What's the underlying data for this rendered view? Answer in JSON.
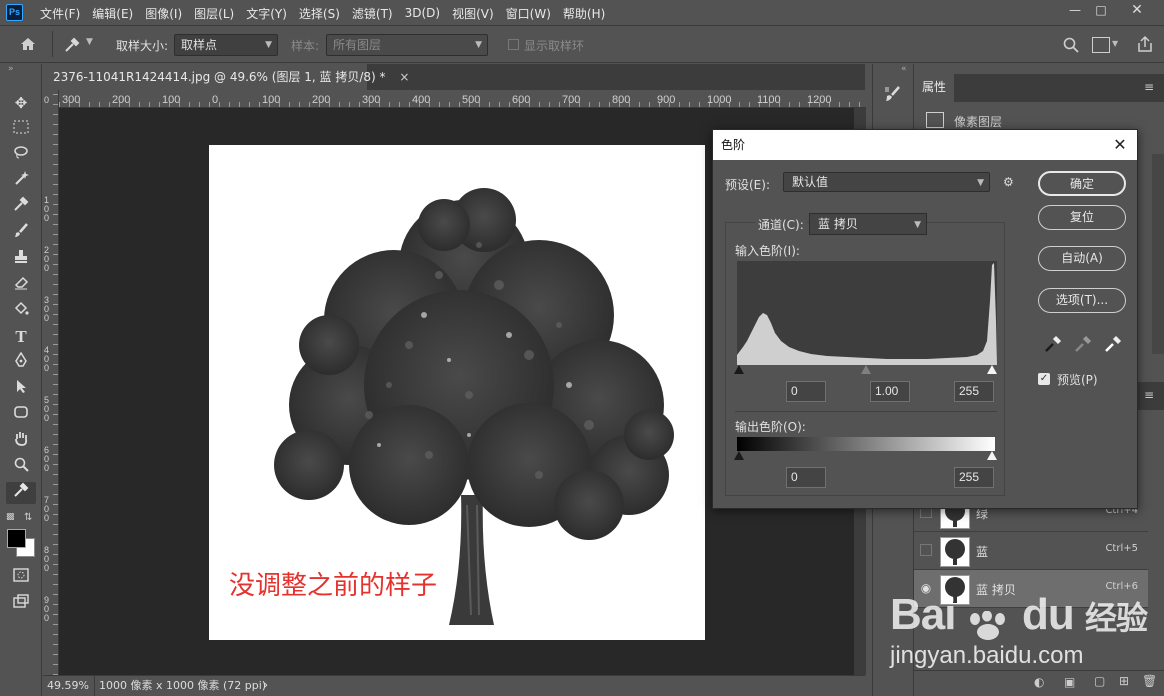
{
  "menubar": {
    "logo": "Ps",
    "items": [
      "文件(F)",
      "编辑(E)",
      "图像(I)",
      "图层(L)",
      "文字(Y)",
      "选择(S)",
      "滤镜(T)",
      "3D(D)",
      "视图(V)",
      "窗口(W)",
      "帮助(H)"
    ]
  },
  "options": {
    "sample_size_label": "取样大小:",
    "sample_size_value": "取样点",
    "sample_label": "样本:",
    "sample_value": "所有图层",
    "show_ring_label": "显示取样环"
  },
  "document": {
    "tab_title": "2376-11041R1424414.jpg @ 49.6% (图层 1, 蓝 拷贝/8) *",
    "close_glyph": "×",
    "annotation": "没调整之前的样子"
  },
  "rulers": {
    "h_ticks": [
      "300",
      "200",
      "100",
      "0",
      "100",
      "200",
      "300",
      "400",
      "500",
      "600",
      "700",
      "800",
      "900",
      "1000",
      "1100",
      "1200"
    ],
    "v_ticks": [
      "0",
      "1 0 0",
      "2 0 0",
      "3 0 0",
      "4 0 0",
      "5 0 0",
      "6 0 0",
      "7 0 0",
      "8 0 0",
      "9 0 0"
    ]
  },
  "status": {
    "zoom": "49.59%",
    "doc_info": "1000 像素 x 1000 像素 (72 ppi)",
    "arrow": "›"
  },
  "properties_panel": {
    "tab_label": "属性",
    "pixel_layer_label": "像素图层"
  },
  "layers": [
    {
      "name": "绿",
      "shortcut": "Ctrl+4",
      "visible": false,
      "selected": false
    },
    {
      "name": "蓝",
      "shortcut": "Ctrl+5",
      "visible": false,
      "selected": false
    },
    {
      "name": "蓝 拷贝",
      "shortcut": "Ctrl+6",
      "visible": true,
      "selected": true
    }
  ],
  "levels_dialog": {
    "title": "色阶",
    "preset_label": "预设(E):",
    "preset_value": "默认值",
    "channel_label": "通道(C):",
    "channel_value": "蓝 拷贝",
    "input_levels_label": "输入色阶(I):",
    "input_black": "0",
    "input_gamma": "1.00",
    "input_white": "255",
    "output_levels_label": "输出色阶(O):",
    "output_black": "0",
    "output_white": "255",
    "ok_label": "确定",
    "reset_label": "复位",
    "auto_label": "自动(A)",
    "options_label": "选项(T)...",
    "preview_label": "预览(P)",
    "preview_checked": true
  },
  "watermark": {
    "brand": "Bai",
    "brand2": "du",
    "brand_cn": "经验",
    "url": "jingyan.baidu.com"
  },
  "colors": {
    "ui_bg": "#535353",
    "canvas_bg": "#282828",
    "annotation": "#e5322d",
    "accent_blue": "#31a8ff"
  }
}
